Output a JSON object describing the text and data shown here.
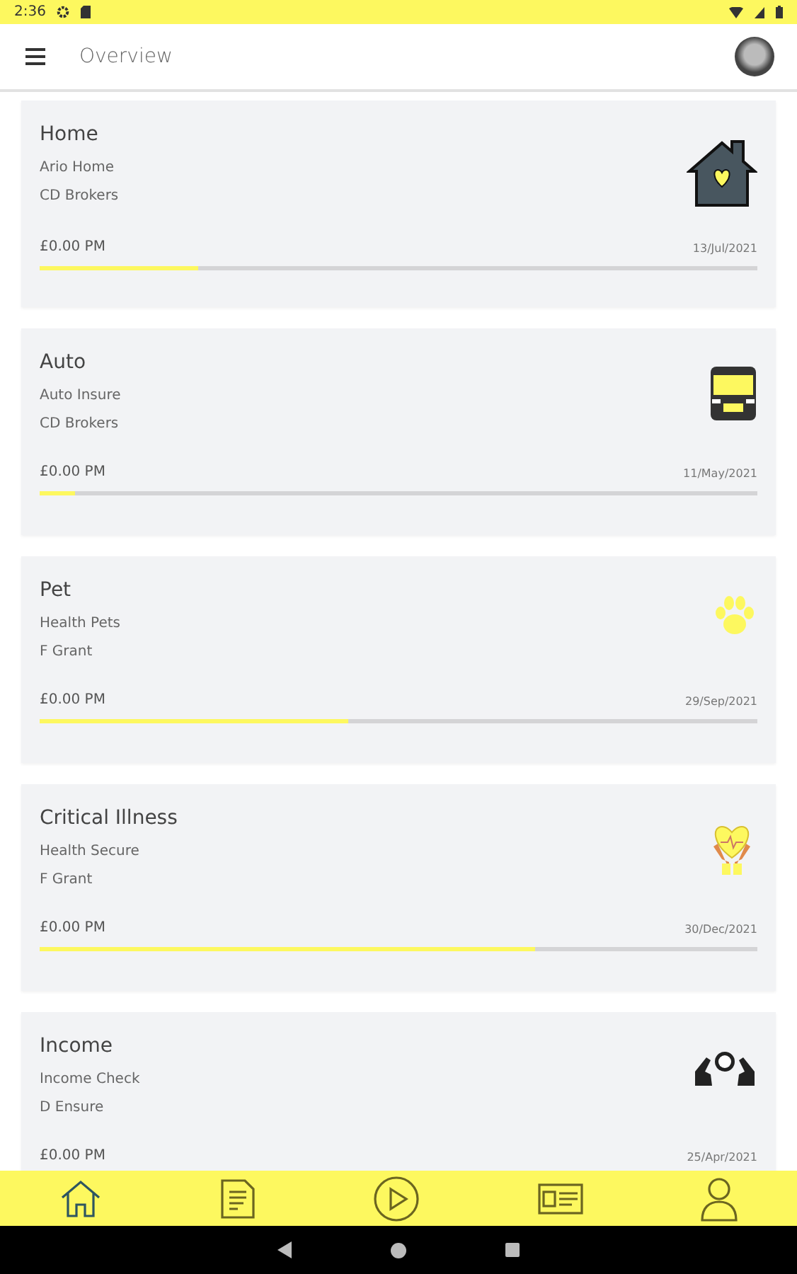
{
  "status_bar": {
    "time": "2:36"
  },
  "app_bar": {
    "title": "Overview"
  },
  "policies": [
    {
      "title": "Home",
      "product": "Ario Home",
      "broker": "CD Brokers",
      "amount": "£0.00 PM",
      "date": "13/Jul/2021",
      "level": 0.22,
      "kind": "house"
    },
    {
      "title": "Auto",
      "product": "Auto Insure",
      "broker": "CD Brokers",
      "amount": "£0.00 PM",
      "date": "11/May/2021",
      "level": 0.05,
      "kind": "truck"
    },
    {
      "title": "Pet",
      "product": "Health Pets",
      "broker": "F Grant",
      "amount": "£0.00 PM",
      "date": "29/Sep/2021",
      "level": 0.43,
      "kind": "paw"
    },
    {
      "title": "Critical Illness",
      "product": "Health Secure",
      "broker": "F Grant",
      "amount": "£0.00 PM",
      "date": "30/Dec/2021",
      "level": 0.69,
      "kind": "heart-hands"
    },
    {
      "title": "Income",
      "product": "Income Check",
      "broker": "D Ensure",
      "amount": "£0.00 PM",
      "date": "25/Apr/2021",
      "kind": "money-hands"
    }
  ],
  "bottom_nav": [
    {
      "kind": "home",
      "selected": true
    },
    {
      "kind": "document",
      "selected": false
    },
    {
      "kind": "play",
      "selected": false
    },
    {
      "kind": "card",
      "selected": false
    },
    {
      "kind": "person",
      "selected": false
    }
  ]
}
